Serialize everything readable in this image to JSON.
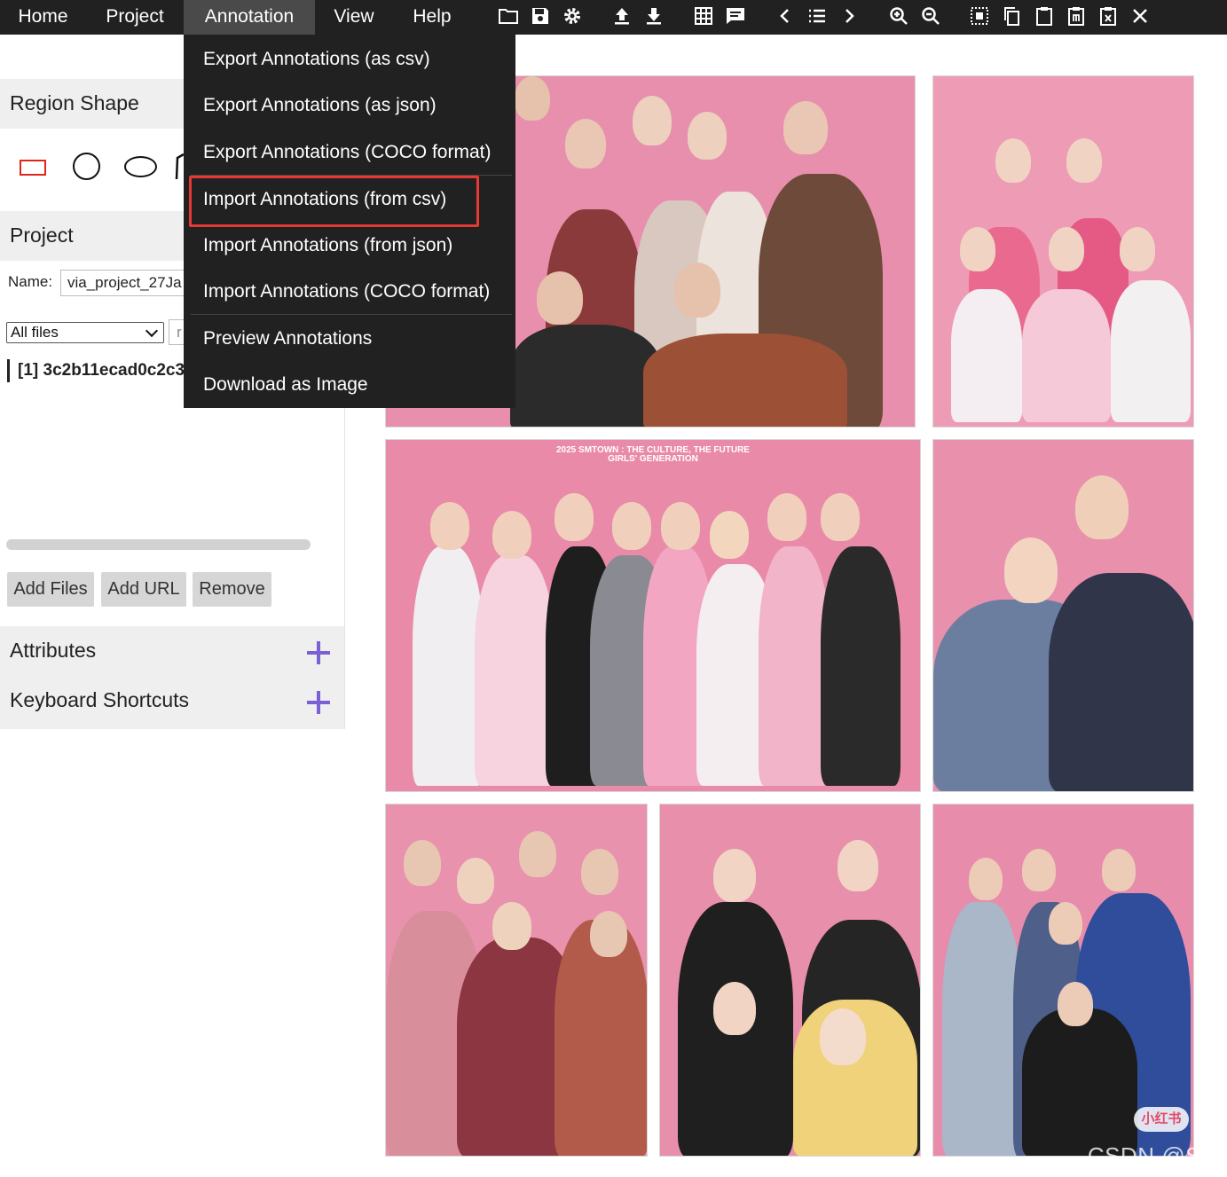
{
  "menubar": {
    "items": [
      "Home",
      "Project",
      "Annotation",
      "View",
      "Help"
    ],
    "active": "Annotation"
  },
  "toolbar": {
    "icons": [
      "folder-icon",
      "save-icon",
      "gear-icon",
      "upload-icon",
      "download-icon",
      "grid-icon",
      "comment-icon",
      "chevron-left-icon",
      "list-icon",
      "chevron-right-icon",
      "zoom-in-icon",
      "zoom-out-icon",
      "select-all-icon",
      "copy-icon",
      "paste-icon",
      "paste-special-icon",
      "delete-region-icon",
      "close-icon"
    ]
  },
  "annotation_menu": {
    "items": [
      "Export Annotations (as csv)",
      "Export Annotations (as json)",
      "Export Annotations (COCO format)",
      "Import Annotations (from csv)",
      "Import Annotations (from json)",
      "Import Annotations (COCO format)",
      "Preview Annotations",
      "Download as Image"
    ],
    "highlighted": "Import Annotations (from csv)",
    "highlight_color": "#e53935"
  },
  "left_panel": {
    "region_shape": {
      "title": "Region Shape",
      "shapes": [
        "rectangle",
        "circle",
        "ellipse",
        "polygon"
      ],
      "active_color": "#e0251d"
    },
    "project": {
      "title": "Project",
      "name_label": "Name:",
      "name_value": "via_project_27Ja",
      "filter_selected": "All files",
      "regex_placeholder": "r",
      "file_entry": "[1] 3c2b11ecad0c2c3"
    },
    "buttons": {
      "add_files": "Add Files",
      "add_url": "Add URL",
      "remove": "Remove"
    },
    "attributes_title": "Attributes",
    "shortcuts_title": "Keyboard Shortcuts",
    "accent_color": "#7b5fd4"
  },
  "gallery": {
    "caption_line1": "2025 SMTOWN : THE CULTURE, THE FUTURE",
    "caption_line2": "GIRLS' GENERATION",
    "watermark_badge": "小红书",
    "watermark_text": "CSDN @Sily",
    "background_color": "#e58aa6"
  }
}
